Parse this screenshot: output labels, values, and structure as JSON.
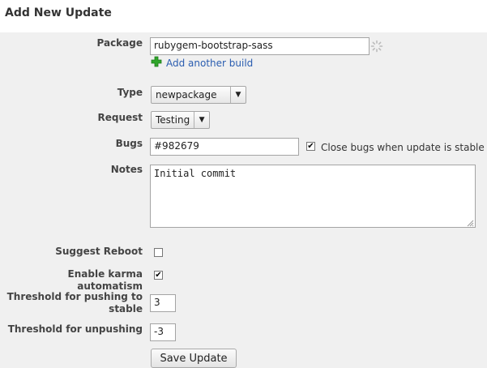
{
  "page": {
    "title": "Add New Update"
  },
  "form": {
    "package": {
      "label": "Package",
      "value": "rubygem-bootstrap-sass",
      "add_build_label": "Add another build"
    },
    "type": {
      "label": "Type",
      "value": "newpackage"
    },
    "request": {
      "label": "Request",
      "value": "Testing"
    },
    "bugs": {
      "label": "Bugs",
      "value": "#982679",
      "close_bugs_label": "Close bugs when update is stable",
      "close_bugs_checked": true
    },
    "notes": {
      "label": "Notes",
      "value": "Initial commit"
    },
    "suggest_reboot": {
      "label": "Suggest Reboot",
      "checked": false
    },
    "karma_automatism": {
      "label": "Enable karma automatism",
      "checked": true
    },
    "threshold_push": {
      "label": "Threshold for pushing to stable",
      "value": "3"
    },
    "threshold_unpush": {
      "label": "Threshold for unpushing",
      "value": "-3"
    },
    "submit_label": "Save Update"
  },
  "icons": {
    "spinner": "loading-spinner-icon",
    "add": "green-plus-icon",
    "dropdown": "triangle-down-icon",
    "resize": "resize-grip-icon"
  },
  "colors": {
    "form_bg": "#f0f0f0",
    "link": "#2a5db0",
    "plus": "#2fa52a"
  }
}
